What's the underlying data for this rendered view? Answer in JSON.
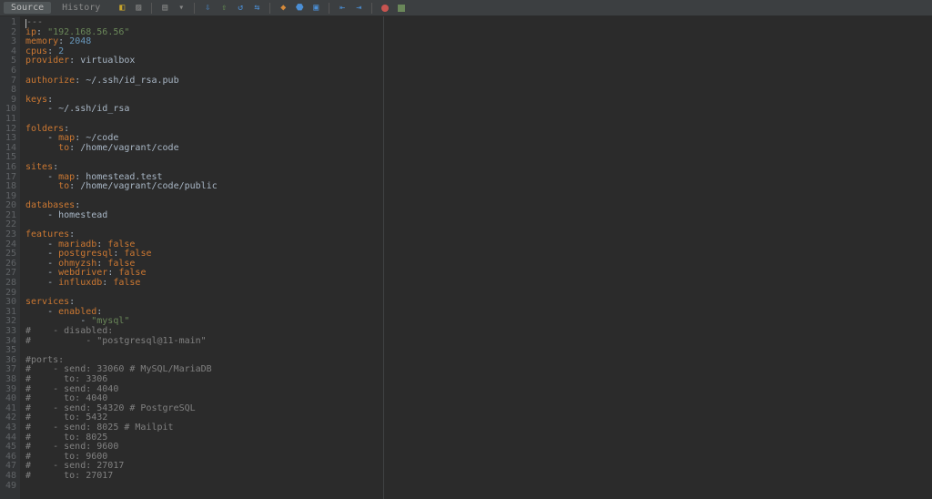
{
  "toolbar": {
    "tabs": [
      {
        "label": "Source",
        "active": true
      },
      {
        "label": "History",
        "active": false
      }
    ]
  },
  "code": {
    "lines": [
      [
        {
          "cursor": true
        },
        {
          "t": "comment",
          "v": "---"
        }
      ],
      [
        {
          "t": "key",
          "v": "ip"
        },
        {
          "t": "plain",
          "v": ": "
        },
        {
          "t": "str",
          "v": "\"192.168.56.56\""
        }
      ],
      [
        {
          "t": "key",
          "v": "memory"
        },
        {
          "t": "plain",
          "v": ": "
        },
        {
          "t": "num",
          "v": "2048"
        }
      ],
      [
        {
          "t": "key",
          "v": "cpus"
        },
        {
          "t": "plain",
          "v": ": "
        },
        {
          "t": "num",
          "v": "2"
        }
      ],
      [
        {
          "t": "key",
          "v": "provider"
        },
        {
          "t": "plain",
          "v": ": "
        },
        {
          "t": "plain",
          "v": "virtualbox"
        }
      ],
      [],
      [
        {
          "t": "key",
          "v": "authorize"
        },
        {
          "t": "plain",
          "v": ": "
        },
        {
          "t": "plain",
          "v": "~/.ssh/id_rsa.pub"
        }
      ],
      [],
      [
        {
          "t": "key",
          "v": "keys"
        },
        {
          "t": "plain",
          "v": ":"
        }
      ],
      [
        {
          "t": "plain",
          "v": "    - "
        },
        {
          "t": "plain",
          "v": "~/.ssh/id_rsa"
        }
      ],
      [],
      [
        {
          "t": "key",
          "v": "folders"
        },
        {
          "t": "plain",
          "v": ":"
        }
      ],
      [
        {
          "t": "plain",
          "v": "    - "
        },
        {
          "t": "key",
          "v": "map"
        },
        {
          "t": "plain",
          "v": ": "
        },
        {
          "t": "plain",
          "v": "~/code"
        }
      ],
      [
        {
          "t": "plain",
          "v": "      "
        },
        {
          "t": "key",
          "v": "to"
        },
        {
          "t": "plain",
          "v": ": "
        },
        {
          "t": "plain",
          "v": "/home/vagrant/code"
        }
      ],
      [],
      [
        {
          "t": "key",
          "v": "sites"
        },
        {
          "t": "plain",
          "v": ":"
        }
      ],
      [
        {
          "t": "plain",
          "v": "    - "
        },
        {
          "t": "key",
          "v": "map"
        },
        {
          "t": "plain",
          "v": ": "
        },
        {
          "t": "plain",
          "v": "homestead.test"
        }
      ],
      [
        {
          "t": "plain",
          "v": "      "
        },
        {
          "t": "key",
          "v": "to"
        },
        {
          "t": "plain",
          "v": ": "
        },
        {
          "t": "plain",
          "v": "/home/vagrant/code/public"
        }
      ],
      [],
      [
        {
          "t": "key",
          "v": "databases"
        },
        {
          "t": "plain",
          "v": ":"
        }
      ],
      [
        {
          "t": "plain",
          "v": "    - "
        },
        {
          "t": "plain",
          "v": "homestead"
        }
      ],
      [],
      [
        {
          "t": "key",
          "v": "features"
        },
        {
          "t": "plain",
          "v": ":"
        }
      ],
      [
        {
          "t": "plain",
          "v": "    - "
        },
        {
          "t": "key",
          "v": "mariadb"
        },
        {
          "t": "plain",
          "v": ": "
        },
        {
          "t": "bool",
          "v": "false"
        }
      ],
      [
        {
          "t": "plain",
          "v": "    - "
        },
        {
          "t": "key",
          "v": "postgresql"
        },
        {
          "t": "plain",
          "v": ": "
        },
        {
          "t": "bool",
          "v": "false"
        }
      ],
      [
        {
          "t": "plain",
          "v": "    - "
        },
        {
          "t": "key",
          "v": "ohmyzsh"
        },
        {
          "t": "plain",
          "v": ": "
        },
        {
          "t": "bool",
          "v": "false"
        }
      ],
      [
        {
          "t": "plain",
          "v": "    - "
        },
        {
          "t": "key",
          "v": "webdriver"
        },
        {
          "t": "plain",
          "v": ": "
        },
        {
          "t": "bool",
          "v": "false"
        }
      ],
      [
        {
          "t": "plain",
          "v": "    - "
        },
        {
          "t": "key",
          "v": "influxdb"
        },
        {
          "t": "plain",
          "v": ": "
        },
        {
          "t": "bool",
          "v": "false"
        }
      ],
      [],
      [
        {
          "t": "key",
          "v": "services"
        },
        {
          "t": "plain",
          "v": ":"
        }
      ],
      [
        {
          "t": "plain",
          "v": "    - "
        },
        {
          "t": "key",
          "v": "enabled"
        },
        {
          "t": "plain",
          "v": ":"
        }
      ],
      [
        {
          "t": "plain",
          "v": "          - "
        },
        {
          "t": "str",
          "v": "\"mysql\""
        }
      ],
      [
        {
          "t": "comment",
          "v": "#    - disabled:"
        }
      ],
      [
        {
          "t": "comment",
          "v": "#          - \"postgresql@11-main\""
        }
      ],
      [],
      [
        {
          "t": "comment",
          "v": "#ports:"
        }
      ],
      [
        {
          "t": "comment",
          "v": "#    - send: 33060 # MySQL/MariaDB"
        }
      ],
      [
        {
          "t": "comment",
          "v": "#      to: 3306"
        }
      ],
      [
        {
          "t": "comment",
          "v": "#    - send: 4040"
        }
      ],
      [
        {
          "t": "comment",
          "v": "#      to: 4040"
        }
      ],
      [
        {
          "t": "comment",
          "v": "#    - send: 54320 # PostgreSQL"
        }
      ],
      [
        {
          "t": "comment",
          "v": "#      to: 5432"
        }
      ],
      [
        {
          "t": "comment",
          "v": "#    - send: 8025 # Mailpit"
        }
      ],
      [
        {
          "t": "comment",
          "v": "#      to: 8025"
        }
      ],
      [
        {
          "t": "comment",
          "v": "#    - send: 9600"
        }
      ],
      [
        {
          "t": "comment",
          "v": "#      to: 9600"
        }
      ],
      [
        {
          "t": "comment",
          "v": "#    - send: 27017"
        }
      ],
      [
        {
          "t": "comment",
          "v": "#      to: 27017"
        }
      ],
      []
    ]
  }
}
